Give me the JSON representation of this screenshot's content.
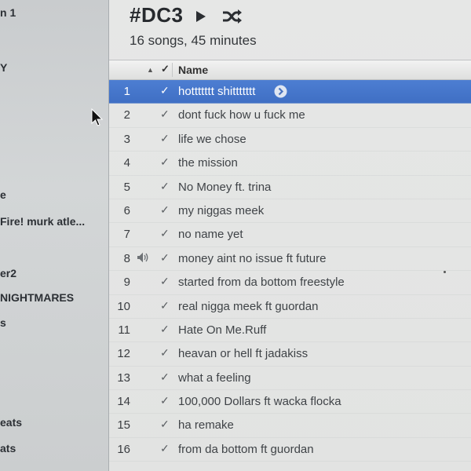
{
  "sidebar": {
    "items": [
      {
        "label": "n 1"
      },
      {
        "label": "Y"
      },
      {
        "label": "e"
      },
      {
        "label": "Fire! murk atle..."
      },
      {
        "label": "er2"
      },
      {
        "label": "NIGHTMARES"
      },
      {
        "label": "s"
      },
      {
        "label": "eats"
      },
      {
        "label": "ats"
      }
    ]
  },
  "playlist": {
    "title": "#DC3",
    "summary": "16 songs, 45 minutes"
  },
  "columns": {
    "check": "✓",
    "name": "Name"
  },
  "songs": [
    {
      "num": "1",
      "title": "hottttttt shittttttt",
      "selected": true
    },
    {
      "num": "2",
      "title": "dont fuck how u fuck me"
    },
    {
      "num": "3",
      "title": "life we chose"
    },
    {
      "num": "4",
      "title": "the mission"
    },
    {
      "num": "5",
      "title": "No Money ft. trina"
    },
    {
      "num": "6",
      "title": "my niggas meek"
    },
    {
      "num": "7",
      "title": "no name yet"
    },
    {
      "num": "8",
      "title": "money aint no issue ft future",
      "playing": true
    },
    {
      "num": "9",
      "title": "started from da bottom freestyle"
    },
    {
      "num": "10",
      "title": "real nigga meek ft guordan"
    },
    {
      "num": "11",
      "title": "Hate On Me.Ruff"
    },
    {
      "num": "12",
      "title": "heavan or hell ft jadakiss"
    },
    {
      "num": "13",
      "title": "what a feeling"
    },
    {
      "num": "14",
      "title": "100,000 Dollars ft wacka flocka"
    },
    {
      "num": "15",
      "title": "ha remake"
    },
    {
      "num": "16",
      "title": "from da bottom ft guordan"
    }
  ],
  "colors": {
    "selection": "#4a7bd0",
    "sidebar_bg": "#cdd0d1",
    "main_bg": "#e4e5e4"
  },
  "icons": {
    "play": "play-icon",
    "shuffle": "shuffle-icon",
    "speaker": "speaker-icon",
    "arrow": "arrow-circle-icon",
    "cursor": "mouse-pointer-icon"
  }
}
